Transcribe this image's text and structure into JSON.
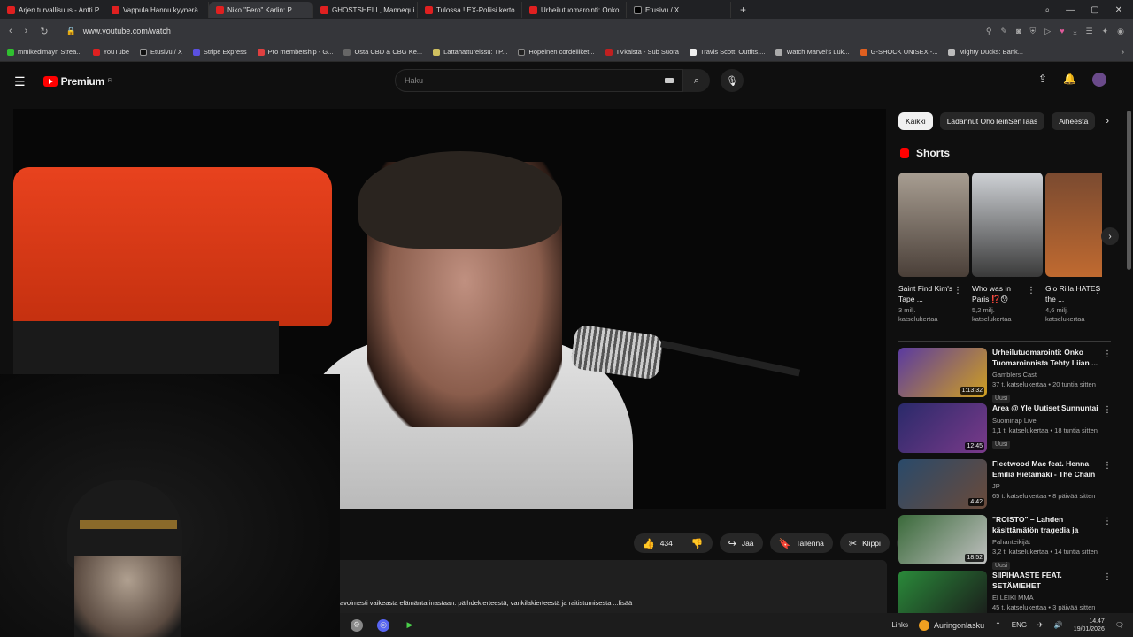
{
  "browser": {
    "tabs": [
      {
        "label": "Arjen turvallisuus - Antti P",
        "icon": "youtube-icon"
      },
      {
        "label": "Vappula Hannu kyynerä...",
        "icon": "youtube-icon"
      },
      {
        "label": "Niko \"Fero\" Karlin: P...",
        "icon": "youtube-icon",
        "active": true
      },
      {
        "label": "GHOSTSHELL, Mannequi...",
        "icon": "youtube-icon"
      },
      {
        "label": "Tulossa ! EX-Poliisi kerto...",
        "icon": "youtube-icon"
      },
      {
        "label": "Urheilutuomarointi: Onko...",
        "icon": "youtube-icon"
      },
      {
        "label": "Etusivu / X",
        "icon": "x-icon"
      }
    ],
    "new_tab": "+",
    "url": "www.youtube.com/watch"
  },
  "bookmarks": [
    "mmikedimayn Strea...",
    "YouTube",
    "Etusivu / X",
    "Stripe Express",
    "Pro membership - G...",
    "Osta CBD & CBG Ke...",
    "Lättähattureissu: TP...",
    "Hopeinen cordelliket...",
    "TVkaista - Sub Suora",
    "Travis Scott: Outfits,...",
    "Watch Marvel's Luk...",
    "G-SHOCK UNISEX -...",
    "Mighty Ducks: Bank..."
  ],
  "youtube": {
    "logo_text": "Premium",
    "logo_sup": "FI",
    "search_placeholder": "Haku"
  },
  "actions": {
    "likes": "434",
    "share": "Jaa",
    "save": "Tallenna",
    "clip": "Klippi",
    "more": "•••"
  },
  "description": "avoimesti vaikeasta elämäntarinastaan: päihdekierteestä, vankilakierteestä ja raitistumisesta  ...lisää",
  "chips": [
    "Kaikki",
    "Ladannut OhoTeinSenTaas",
    "Aiheesta"
  ],
  "shorts_title": "Shorts",
  "shorts": [
    {
      "title": "Saint Find Kim's Tape ...",
      "views": "3 milj. katselukertaa",
      "color1": "#a89e92",
      "color2": "#4a3f38"
    },
    {
      "title": "Who was in Paris ⁉️😯",
      "views": "5,2 milj. katselukertaa",
      "color1": "#cfd2d6",
      "color2": "#3a3a3a"
    },
    {
      "title": "Glo Rilla HATES the ...",
      "views": "4,6 milj. katselukertaa",
      "color1": "#7a4a30",
      "color2": "#c06a30"
    }
  ],
  "recommendations": [
    {
      "title": "Urheilutuomarointi: Onko Tuomaroinnista Tehty Liian ...",
      "channel": "Gamblers Cast",
      "meta": "37 t. katselukertaa • 20 tuntia sitten",
      "badge": "Uusi",
      "duration": "1:13:32",
      "color1": "#5a3aa0",
      "color2": "#d0a020"
    },
    {
      "title": "Area @ Yle Uutiset Sunnuntai",
      "channel": "Suominap Live",
      "meta": "1,1 t. katselukertaa • 18 tuntia sitten",
      "badge": "Uusi",
      "duration": "12:45",
      "color1": "#2a2a6a",
      "color2": "#7a3a8a"
    },
    {
      "title": "Fleetwood Mac feat. Henna Emilia Hietamäki - The Chain",
      "channel": "JP",
      "meta": "65 t. katselukertaa • 8 päivää sitten",
      "badge": "",
      "duration": "4:42",
      "color1": "#2a4a6a",
      "color2": "#6a4a3a"
    },
    {
      "title": "\"ROISTO\" – Lahden käsittämätön tragedia ja klovni...",
      "channel": "Pahanteikijät",
      "meta": "3,2 t. katselukertaa • 14 tuntia sitten",
      "badge": "Uusi",
      "duration": "18:52",
      "color1": "#3a6a3a",
      "color2": "#c0c0c0"
    },
    {
      "title": "SIIPIHAASTE FEAT. SETÄMIEHET",
      "channel": "El LEIKI MMA",
      "meta": "45 t. katselukertaa • 3 päivää sitten",
      "badge": "",
      "duration": "",
      "color1": "#2a8a3a",
      "color2": "#1a1a1a"
    }
  ],
  "taskbar": {
    "links": "Links",
    "weather": "Auringonlasku",
    "lang": "ENG",
    "time": "14.47",
    "date": "19/01/2026"
  }
}
